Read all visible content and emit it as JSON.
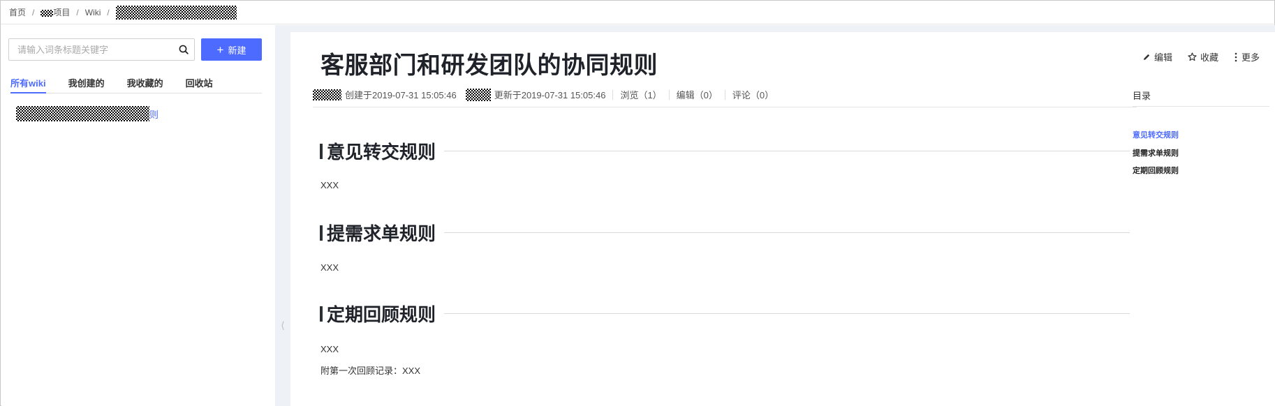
{
  "breadcrumb": {
    "home": "首页",
    "sep": "/",
    "project_suffix": "项目",
    "wiki": "Wiki"
  },
  "sidebar": {
    "search_placeholder": "请输入词条标题关键字",
    "new_button": "新建",
    "tabs": [
      "所有wiki",
      "我创建的",
      "我收藏的",
      "回收站"
    ],
    "active_tab": 0,
    "wiki_item_suffix": "则"
  },
  "document": {
    "title": "客服部门和研发团队的协同规则",
    "created_label": "创建于2019-07-31 15:05:46",
    "updated_label": "更新于2019-07-31 15:05:46",
    "views": "浏览（1）",
    "edits": "编辑（0）",
    "comments": "评论（0）",
    "sections": [
      {
        "heading": "意见转交规则",
        "body": [
          "XXX"
        ]
      },
      {
        "heading": "提需求单规则",
        "body": [
          "XXX"
        ]
      },
      {
        "heading": "定期回顾规则",
        "body": [
          "XXX",
          "附第一次回顾记录：XXX"
        ]
      }
    ]
  },
  "toolbar": {
    "edit": "编辑",
    "favorite": "收藏",
    "more": "更多"
  },
  "toc": {
    "title": "目录",
    "items": [
      "意见转交规则",
      "提需求单规则",
      "定期回顾规则"
    ],
    "active_index": 0
  },
  "colors": {
    "accent": "#4d6bfe",
    "gutter": "#eef1f6",
    "heading": "#1f2329"
  }
}
